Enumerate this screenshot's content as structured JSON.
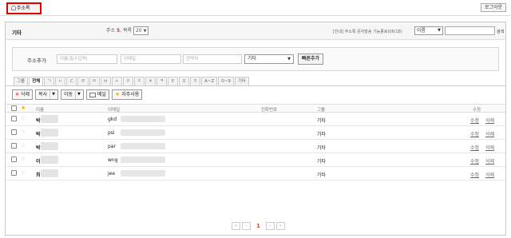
{
  "topbar": {
    "addressbook_label": "주소록",
    "logout_label": "로그아웃"
  },
  "header": {
    "folder_title": "기타",
    "count_prefix": "주소",
    "count": "5",
    "count_sep": ", 목록",
    "per_page": "20",
    "notice": "[안내] 주소록 문자발송 기능종료(06/18)",
    "search_field": "이름",
    "search_button": "검색"
  },
  "quickadd": {
    "label": "주소추가",
    "name_placeholder": "이름(필수입력)",
    "email_placeholder": "이메일",
    "phone_placeholder": "연락처",
    "group_value": "기타",
    "submit_label": "빠른추가"
  },
  "tabs": [
    "그룹",
    "전체",
    "ㄱ",
    "ㄴ",
    "ㄷ",
    "ㄹ",
    "ㅁ",
    "ㅂ",
    "ㅅ",
    "ㅇ",
    "ㅈ",
    "ㅊ",
    "ㅋ",
    "ㅌ",
    "ㅍ",
    "ㅎ",
    "A~Z",
    "0~9",
    "기타"
  ],
  "toolbar": {
    "delete": "삭제",
    "copy": "복사",
    "move": "이동",
    "mail": "메일",
    "favorite": "자주사용"
  },
  "columns": {
    "name": "이름",
    "email": "이메일",
    "phone": "전화번호",
    "group": "그룹",
    "edit": "수정"
  },
  "rows": [
    {
      "name": "박",
      "email": "gkd",
      "group": "기타",
      "edit": "수정",
      "delete": "삭제"
    },
    {
      "name": "박",
      "email": "psi",
      "group": "기타",
      "edit": "수정",
      "delete": "삭제"
    },
    {
      "name": "박",
      "email": "par",
      "group": "기타",
      "edit": "수정",
      "delete": "삭제"
    },
    {
      "name": "이",
      "email": "wng",
      "group": "기타",
      "edit": "수정",
      "delete": "삭제"
    },
    {
      "name": "최",
      "email": "jee",
      "group": "기타",
      "edit": "수정",
      "delete": "삭제"
    }
  ],
  "pager": {
    "first": "«",
    "prev": "‹",
    "current": "1",
    "next": "›",
    "last": "»"
  }
}
